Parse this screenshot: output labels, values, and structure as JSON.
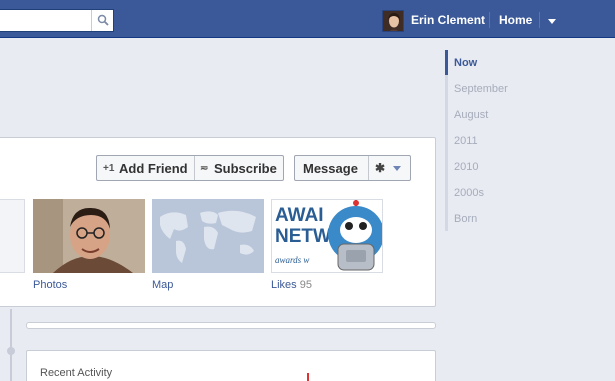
{
  "header": {
    "search_placeholder": "",
    "user_name": "Erin Clement",
    "home_label": "Home"
  },
  "profile": {
    "add_friend_icon": "+1",
    "add_friend_label": "Add Friend",
    "subscribe_icon": "≂",
    "subscribe_label": "Subscribe",
    "message_label": "Message",
    "settings_icon": "✱",
    "thumbnails": {
      "photos": {
        "label": "Photos"
      },
      "map": {
        "label": "Map"
      },
      "likes": {
        "label": "Likes",
        "count": "95",
        "logo_line1": "AWAI",
        "logo_line2": "NETW",
        "logo_line3": "awards w"
      }
    }
  },
  "activity": {
    "title": "Recent Activity"
  },
  "timeline_nav": {
    "items": [
      "Now",
      "September",
      "August",
      "2011",
      "2010",
      "2000s",
      "Born"
    ]
  },
  "colors": {
    "brand": "#3b5998",
    "background": "#e9ebf2"
  },
  "icons": [
    "search-icon",
    "avatar-image",
    "dropdown-caret-icon",
    "add-friend-icon",
    "subscribe-icon",
    "gear-icon"
  ]
}
